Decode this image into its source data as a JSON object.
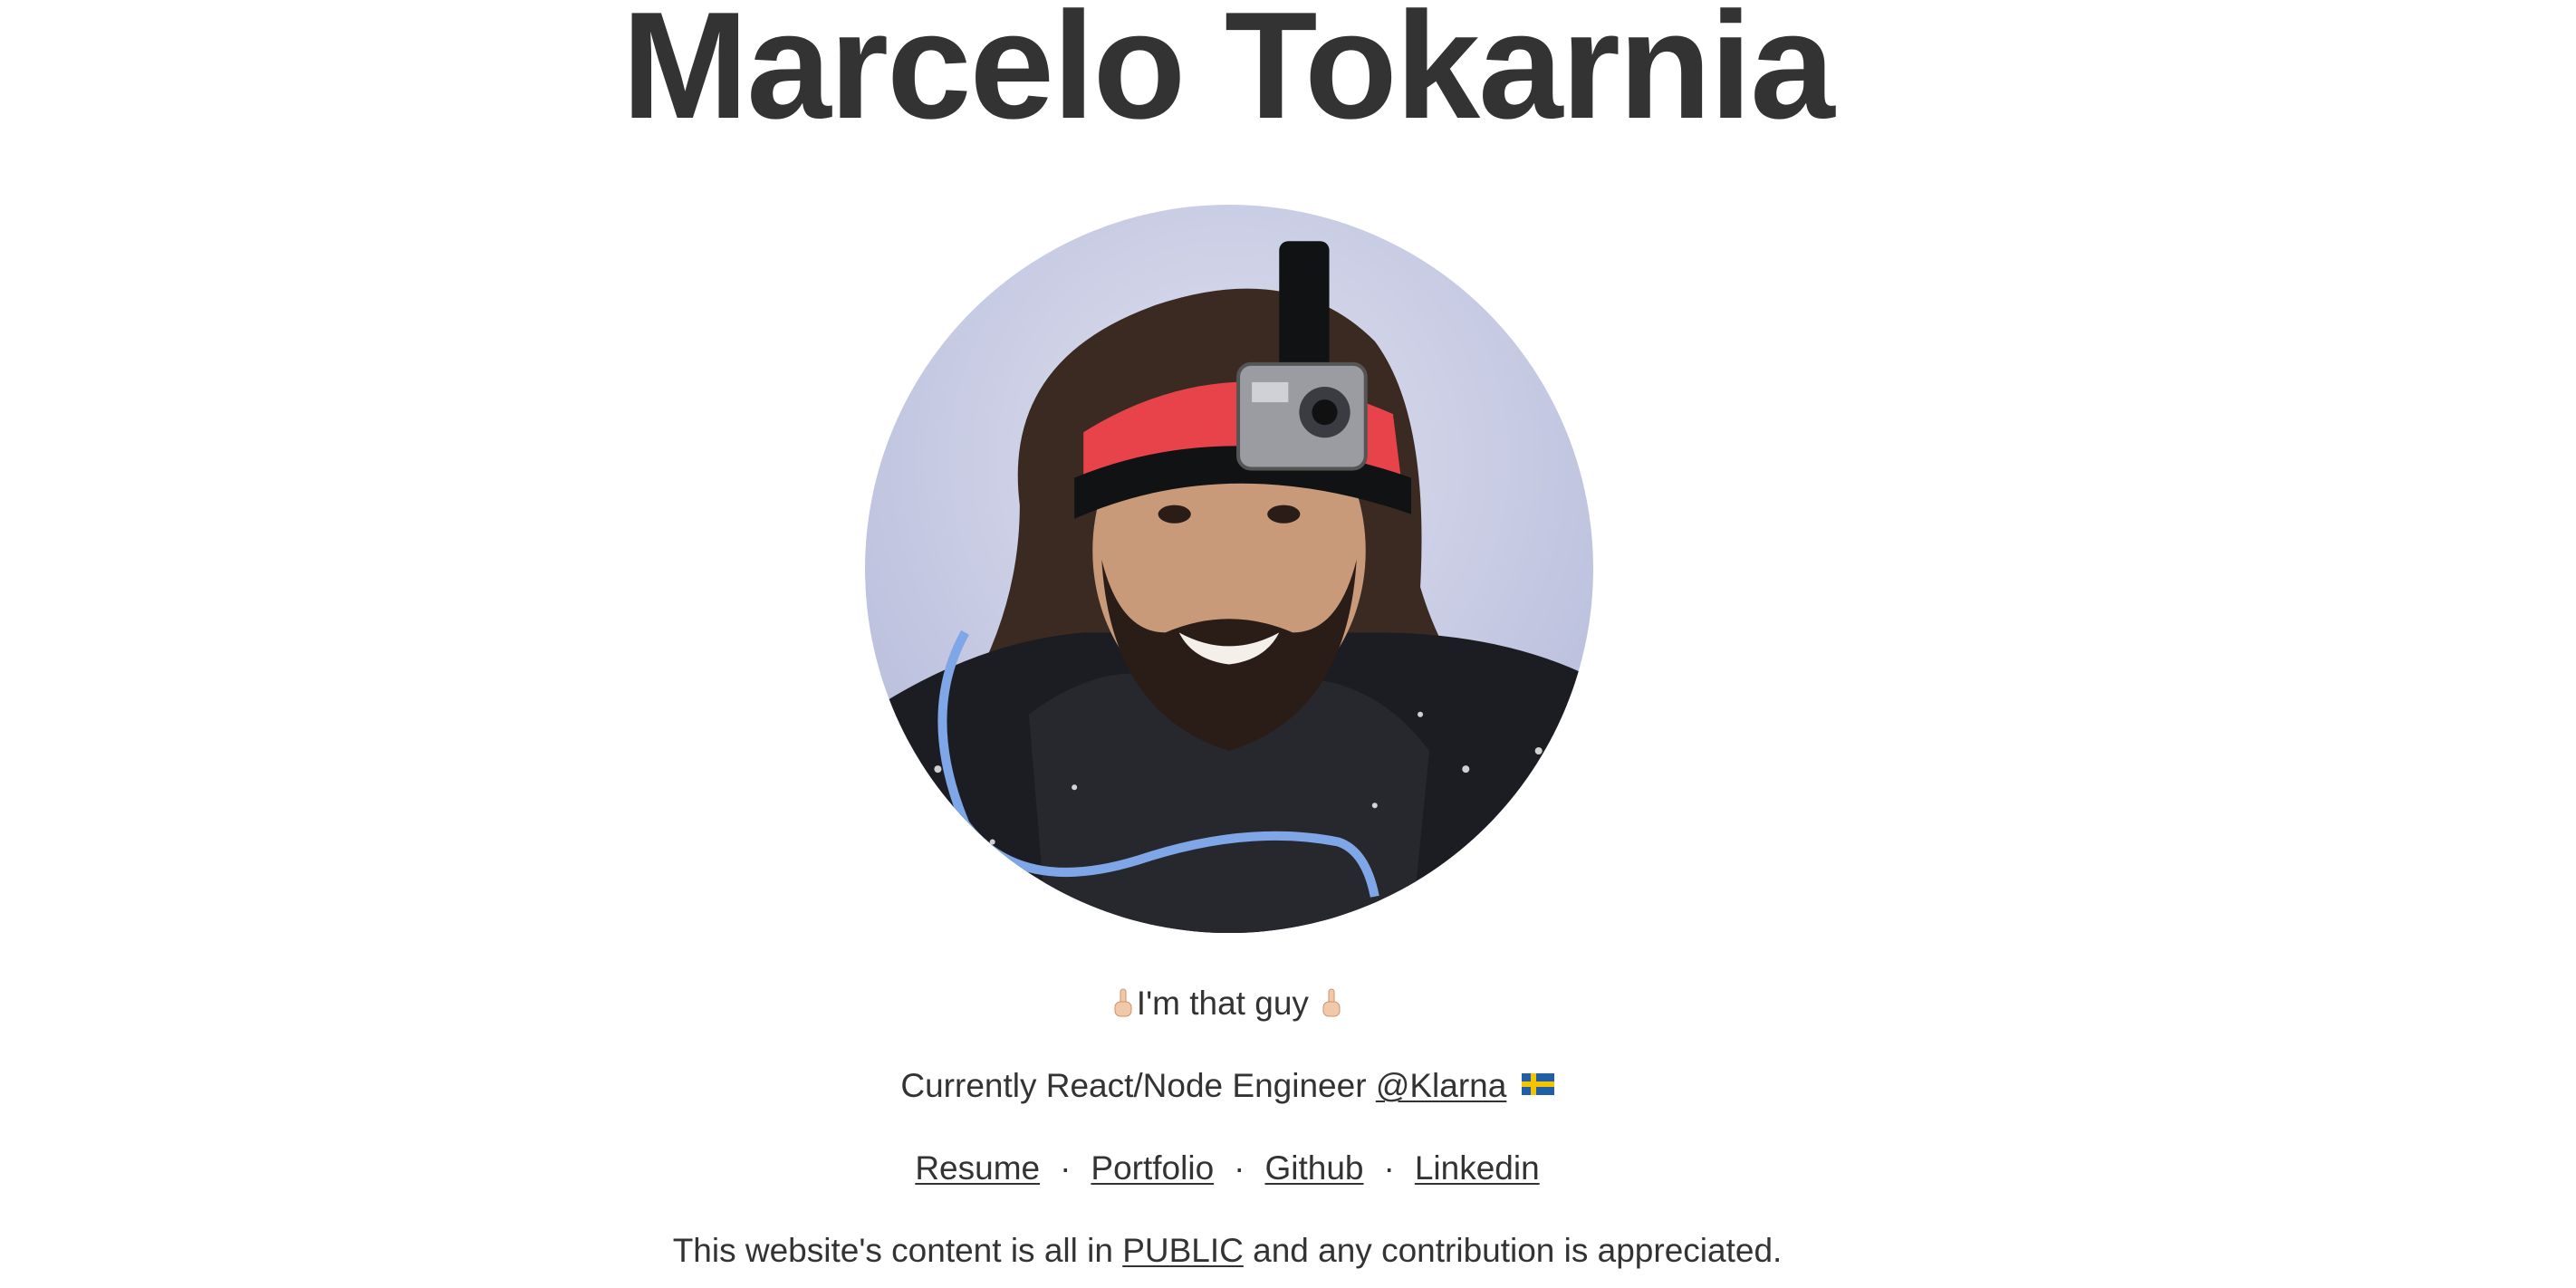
{
  "header": {
    "title": "Marcelo Tokarnia"
  },
  "profile": {
    "photo_icon": "profile-photo",
    "tagline": "I'm that guy",
    "job_prefix": "Currently React/Node Engineer",
    "job_link": "@Klarna",
    "flag_icon": "sweden-flag-icon"
  },
  "links": {
    "items": [
      "Resume",
      "Portfolio",
      "Github",
      "Linkedin"
    ],
    "separator": "·"
  },
  "footer": {
    "prefix": "This website's content is all in",
    "link": "PUBLIC",
    "suffix": "and any contribution is appreciated."
  },
  "colors": {
    "text": "#333333",
    "background": "#ffffff",
    "bandana": "#e8434b",
    "sky": "#c9cde6"
  }
}
